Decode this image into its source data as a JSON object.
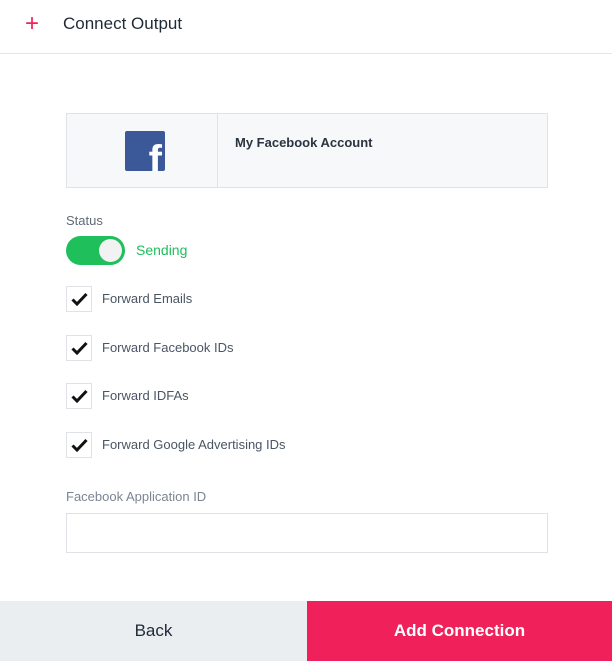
{
  "header": {
    "icon": "plus-icon",
    "title": "Connect Output"
  },
  "account": {
    "logo_icon": "facebook-logo-icon",
    "name": "My Facebook Account"
  },
  "status": {
    "label": "Status",
    "toggle_on": true,
    "state_text": "Sending"
  },
  "options": [
    {
      "label": "Forward Emails",
      "checked": true
    },
    {
      "label": "Forward Facebook IDs",
      "checked": true
    },
    {
      "label": "Forward IDFAs",
      "checked": true
    },
    {
      "label": "Forward Google Advertising IDs",
      "checked": true
    }
  ],
  "app_id": {
    "label": "Facebook Application ID",
    "value": "",
    "placeholder": ""
  },
  "footer": {
    "back_label": "Back",
    "add_label": "Add Connection"
  },
  "colors": {
    "accent": "#f0205a",
    "toggle_green": "#1fbf5c",
    "facebook_blue": "#3b5998"
  }
}
